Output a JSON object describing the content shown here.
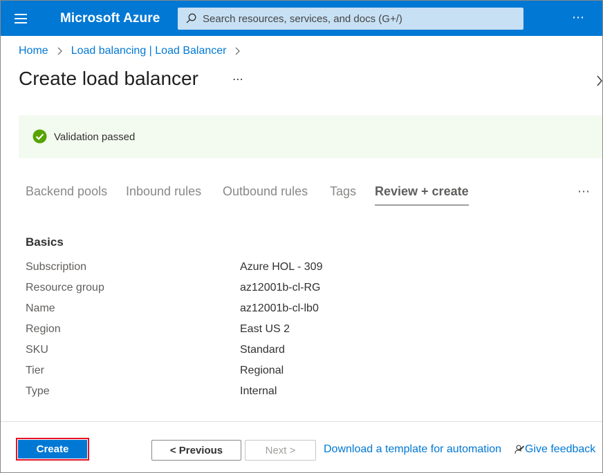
{
  "header": {
    "brand": "Microsoft Azure",
    "search_placeholder": "Search resources, services, and docs (G+/)",
    "more": "⋯"
  },
  "breadcrumb": {
    "items": [
      "Home",
      "Load balancing | Load Balancer"
    ]
  },
  "page": {
    "title": "Create load balancer",
    "more": "⋯"
  },
  "validation": {
    "message": "Validation passed",
    "status_color": "#57a300"
  },
  "tabs": {
    "items": [
      "Backend pools",
      "Inbound rules",
      "Outbound rules",
      "Tags",
      "Review + create"
    ],
    "active": "Review + create",
    "more": "⋯"
  },
  "basics": {
    "title": "Basics",
    "rows": [
      {
        "label": "Subscription",
        "value": "Azure HOL - 309"
      },
      {
        "label": "Resource group",
        "value": "az12001b-cl-RG"
      },
      {
        "label": "Name",
        "value": "az12001b-cl-lb0"
      },
      {
        "label": "Region",
        "value": "East US 2"
      },
      {
        "label": "SKU",
        "value": "Standard"
      },
      {
        "label": "Tier",
        "value": "Regional"
      },
      {
        "label": "Type",
        "value": "Internal"
      }
    ]
  },
  "footer": {
    "create_label": "Create",
    "previous_label": "< Previous",
    "next_label": "Next >",
    "download_link": "Download a template for automation",
    "feedback_label": "Give feedback"
  },
  "colors": {
    "accent": "#0078d4",
    "highlight_border": "#e81123",
    "validation_bg": "#f3faf0"
  }
}
